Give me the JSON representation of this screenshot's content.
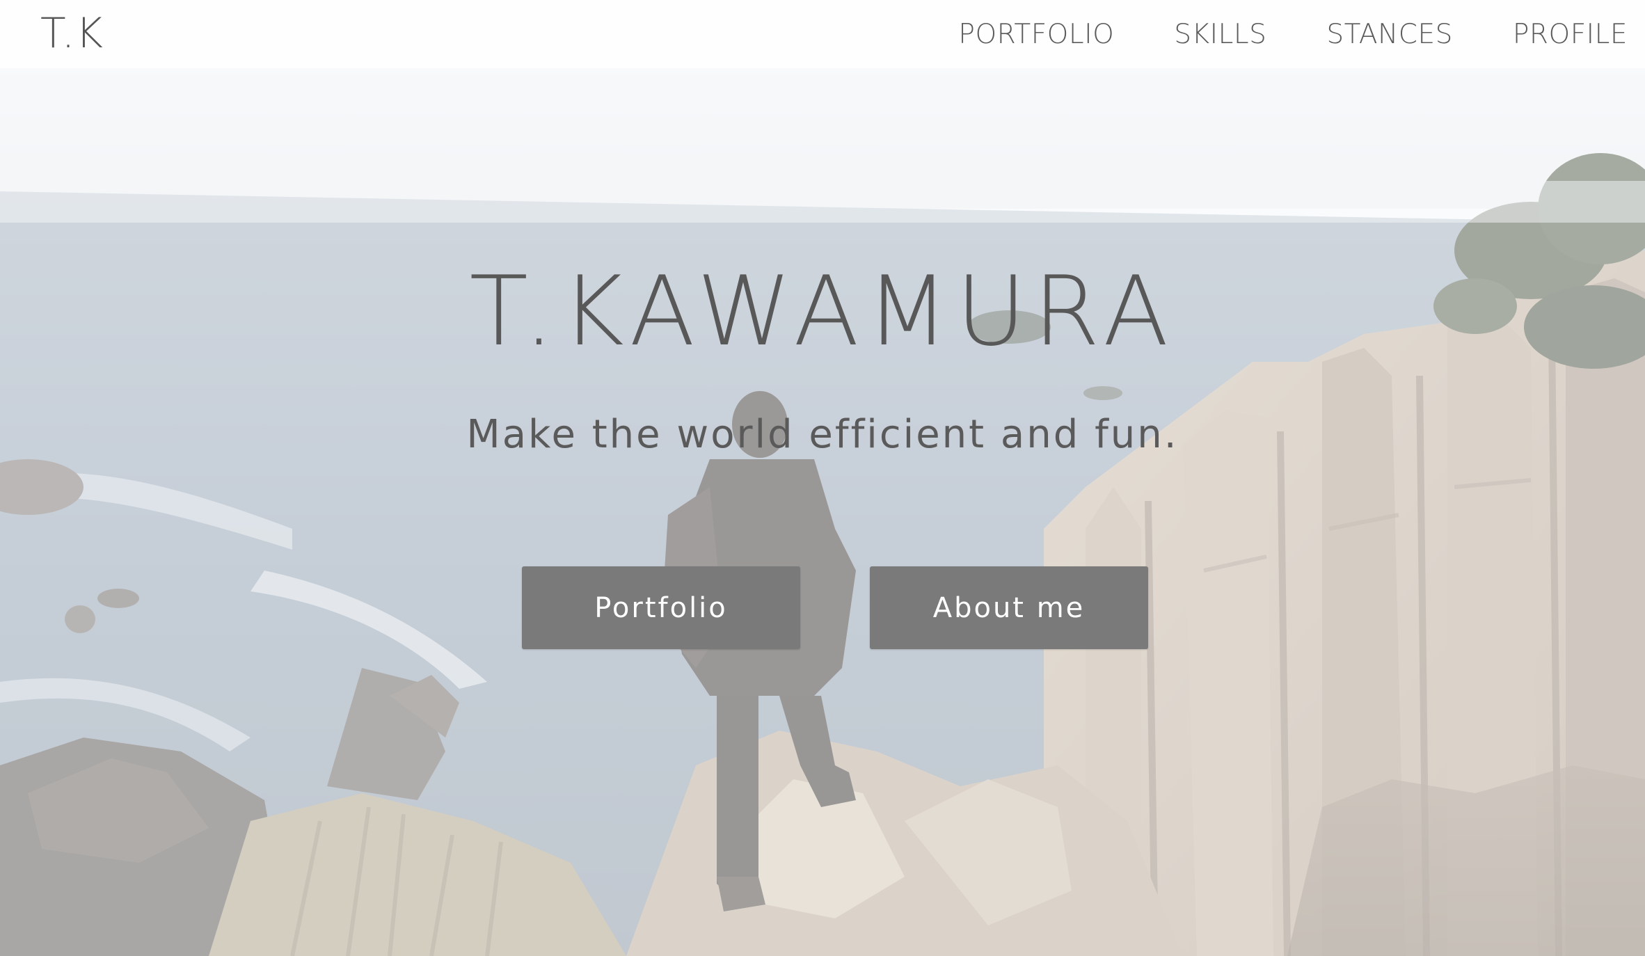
{
  "header": {
    "logo": "T.K",
    "nav": [
      {
        "label": "PORTFOLIO"
      },
      {
        "label": "SKILLS"
      },
      {
        "label": "STANCES"
      },
      {
        "label": "PROFILE"
      }
    ]
  },
  "hero": {
    "title": "T.KAWAMURA",
    "tagline": "Make the world efficient and fun.",
    "buttons": [
      {
        "label": "Portfolio"
      },
      {
        "label": "About me"
      }
    ]
  },
  "colors": {
    "button_bg": "#7a7a7a",
    "text": "#585858",
    "header_bg": "#ffffff"
  }
}
